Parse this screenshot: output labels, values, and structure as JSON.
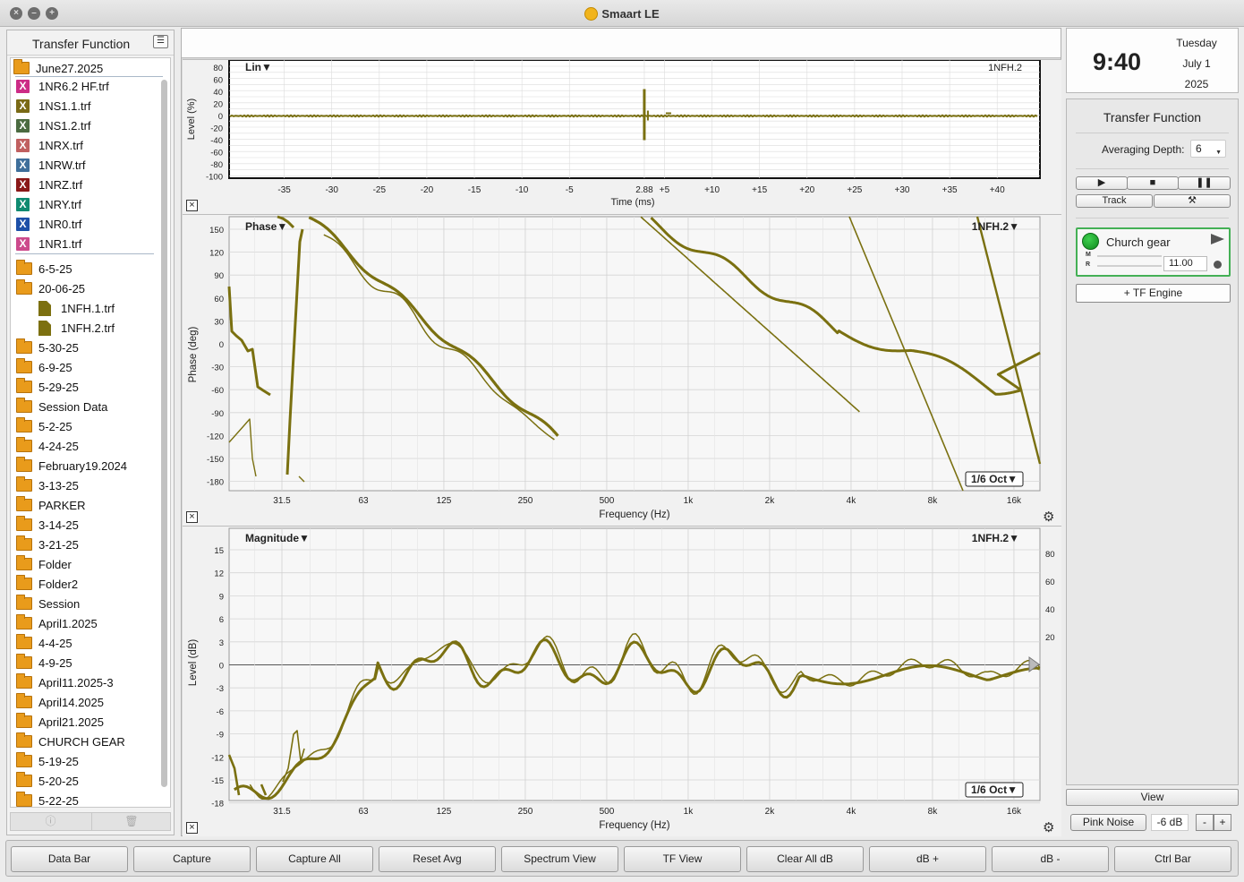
{
  "window": {
    "title": "Smaart LE"
  },
  "left_panel": {
    "title": "Transfer Function",
    "root_folder": "June27.2025",
    "tf_files": [
      {
        "name": "1NR6.2 HF.trf",
        "color": "#cc2c86"
      },
      {
        "name": "1NS1.1.trf",
        "color": "#7a6a16"
      },
      {
        "name": "1NS1.2.trf",
        "color": "#4b6b41"
      },
      {
        "name": "1NRX.trf",
        "color": "#c06060"
      },
      {
        "name": "1NRW.trf",
        "color": "#3f6f9b"
      },
      {
        "name": "1NRZ.trf",
        "color": "#8a1818"
      },
      {
        "name": "1NRY.trf",
        "color": "#0f8a70"
      },
      {
        "name": "1NR0.trf",
        "color": "#1d50a8"
      },
      {
        "name": "1NR1.trf",
        "color": "#cc4a8c"
      }
    ],
    "folders_before": [
      "6-5-25",
      "20-06-25"
    ],
    "open_children": [
      "1NFH.1.trf",
      "1NFH.2.trf"
    ],
    "folders_after": [
      "5-30-25",
      "6-9-25",
      "5-29-25",
      "Session Data",
      "5-2-25",
      "4-24-25",
      "February19.2024",
      "3-13-25",
      "PARKER",
      "3-14-25",
      "3-21-25",
      "Folder",
      "Folder2",
      "Session",
      "April1.2025",
      "4-4-25",
      "4-9-25",
      "April11.2025-3",
      "April14.2025",
      "April21.2025",
      "CHURCH GEAR",
      "5-19-25",
      "5-20-25",
      "5-22-25"
    ]
  },
  "impulse_plot": {
    "mode": "Lin▼",
    "trace": "1NFH.2",
    "ylabel": "Level (%)",
    "xlabel": "Time (ms)",
    "yticks": [
      "80",
      "60",
      "40",
      "20",
      "0",
      "-20",
      "-40",
      "-60",
      "-80",
      "-100"
    ],
    "xticks": [
      "-35",
      "-30",
      "-25",
      "-20",
      "-15",
      "-10",
      "-5",
      "2.88",
      "+5",
      "+10",
      "+15",
      "+20",
      "+25",
      "+30",
      "+35",
      "+40"
    ],
    "peak_ms": 2.88
  },
  "phase_plot": {
    "title": "Phase▼",
    "trace": "1NFH.2▼",
    "ylabel": "Phase (deg)",
    "xlabel": "Frequency (Hz)",
    "smoothing": "1/6 Oct▼",
    "yticks": [
      "150",
      "120",
      "90",
      "60",
      "30",
      "0",
      "-30",
      "-60",
      "-90",
      "-120",
      "-150",
      "-180"
    ],
    "xticks": [
      "31.5",
      "63",
      "125",
      "250",
      "500",
      "1k",
      "2k",
      "4k",
      "8k",
      "16k"
    ]
  },
  "magnitude_plot": {
    "title": "Magnitude▼",
    "trace": "1NFH.2▼",
    "ylabel": "Level (dB)",
    "xlabel": "Frequency (Hz)",
    "smoothing": "1/6 Oct▼",
    "yticks": [
      "15",
      "12",
      "9",
      "6",
      "3",
      "0",
      "-3",
      "-6",
      "-9",
      "-12",
      "-15",
      "-18"
    ],
    "xticks": [
      "31.5",
      "63",
      "125",
      "250",
      "500",
      "1k",
      "2k",
      "4k",
      "8k",
      "16k"
    ],
    "coherence_ticks": [
      "80",
      "60",
      "40",
      "20"
    ]
  },
  "trace_color": "#7a7010",
  "clock": {
    "time": "9:40",
    "weekday": "Tuesday",
    "date": "July 1",
    "year": "2025"
  },
  "controls": {
    "title": "Transfer Function",
    "averaging_label": "Averaging Depth:",
    "averaging_value": "6",
    "track_label": "Track",
    "measurement": {
      "name": "Church gear",
      "m_label": "M",
      "r_label": "R",
      "delay": "11.00"
    },
    "tf_engine_label": "+ TF Engine"
  },
  "view_label": "View",
  "generator": {
    "label": "Pink Noise",
    "level": "-6 dB",
    "minus": "-",
    "plus": "+"
  },
  "command_bar": [
    "Data Bar",
    "Capture",
    "Capture All",
    "Reset Avg",
    "Spectrum View",
    "TF View",
    "Clear All dB",
    "dB +",
    "dB -",
    "Ctrl Bar"
  ]
}
